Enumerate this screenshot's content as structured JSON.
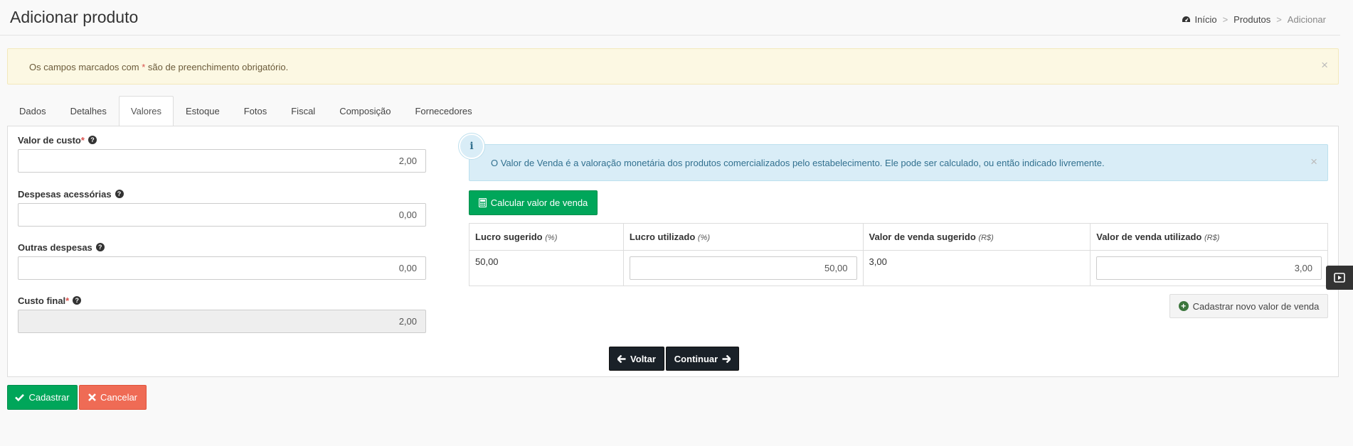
{
  "page": {
    "title": "Adicionar produto"
  },
  "breadcrumb": {
    "home": "Início",
    "products": "Produtos",
    "current": "Adicionar",
    "separator": ">"
  },
  "warning_alert": {
    "text_before": "Os campos marcados com ",
    "asterisk": "*",
    "text_after": " são de preenchimento obrigatório.",
    "close": "×"
  },
  "tabs": [
    {
      "label": "Dados",
      "active": false
    },
    {
      "label": "Detalhes",
      "active": false
    },
    {
      "label": "Valores",
      "active": true
    },
    {
      "label": "Estoque",
      "active": false
    },
    {
      "label": "Fotos",
      "active": false
    },
    {
      "label": "Fiscal",
      "active": false
    },
    {
      "label": "Composição",
      "active": false
    },
    {
      "label": "Fornecedores",
      "active": false
    }
  ],
  "fields": {
    "cost": {
      "label": "Valor de custo",
      "required": "*",
      "value": "2,00",
      "help": "?"
    },
    "accessory": {
      "label": "Despesas acessórias",
      "value": "0,00",
      "help": "?"
    },
    "other": {
      "label": "Outras despesas",
      "value": "0,00",
      "help": "?"
    },
    "final": {
      "label": "Custo final",
      "required": "*",
      "value": "2,00",
      "help": "?"
    }
  },
  "info_alert": {
    "icon_glyph": "i",
    "text": "O Valor de Venda é a valoração monetária dos produtos comercializados pelo estabelecimento. Ele pode ser calculado, ou então indicado livremente.",
    "close": "×"
  },
  "calc_button": {
    "label": "Calcular valor de venda"
  },
  "price_table": {
    "headers": [
      {
        "label": "Lucro sugerido",
        "unit": "(%)"
      },
      {
        "label": "Lucro utilizado",
        "unit": "(%)"
      },
      {
        "label": "Valor de venda sugerido",
        "unit": "(R$)"
      },
      {
        "label": "Valor de venda utilizado",
        "unit": "(R$)"
      }
    ],
    "row": {
      "suggested_profit": "50,00",
      "used_profit": "50,00",
      "suggested_price": "3,00",
      "used_price": "3,00"
    }
  },
  "new_value_button": {
    "label": "Cadastrar novo valor de venda",
    "icon": "+"
  },
  "nav_buttons": {
    "back": "Voltar",
    "next": "Continuar"
  },
  "form_buttons": {
    "save": "Cadastrar",
    "cancel": "Cancelar"
  },
  "colors": {
    "green": "#00a65a",
    "dark": "#1a2128",
    "red": "#ef6b55",
    "info_bg": "#d9edf7",
    "warning_bg": "#fcf8e3"
  }
}
